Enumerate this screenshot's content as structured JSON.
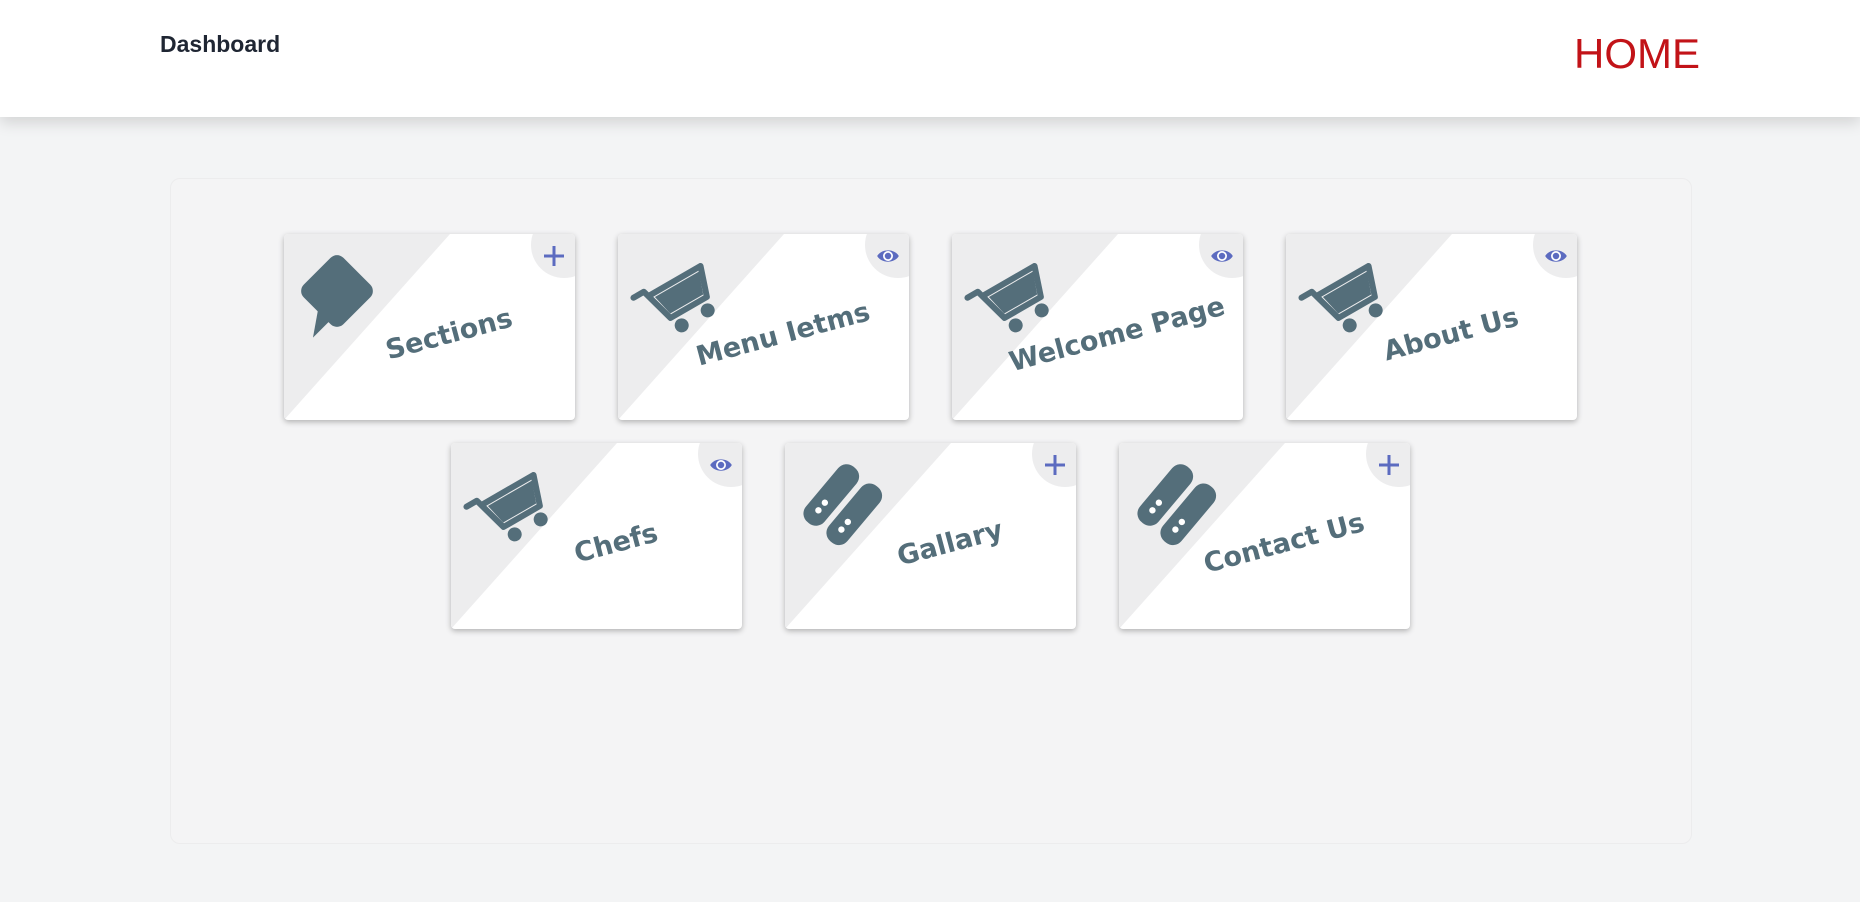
{
  "header": {
    "brand": "Dashboard",
    "home_link": "HOME"
  },
  "colors": {
    "icon": "#546e7a",
    "action_icon": "#5c6bc0",
    "home": "#c21318"
  },
  "cards": [
    {
      "label": "Sections",
      "icon": "label-tag-icon",
      "action": "add-icon"
    },
    {
      "label": "Menu Ietms",
      "icon": "cart-icon",
      "action": "eye-icon"
    },
    {
      "label": "Welcome Page",
      "icon": "cart-icon",
      "action": "eye-icon"
    },
    {
      "label": "About Us",
      "icon": "cart-icon",
      "action": "eye-icon"
    },
    {
      "label": "Chefs",
      "icon": "cart-icon",
      "action": "eye-icon"
    },
    {
      "label": "Gallary",
      "icon": "servers-icon",
      "action": "add-icon"
    },
    {
      "label": "Contact Us",
      "icon": "servers-icon",
      "action": "add-icon"
    }
  ]
}
